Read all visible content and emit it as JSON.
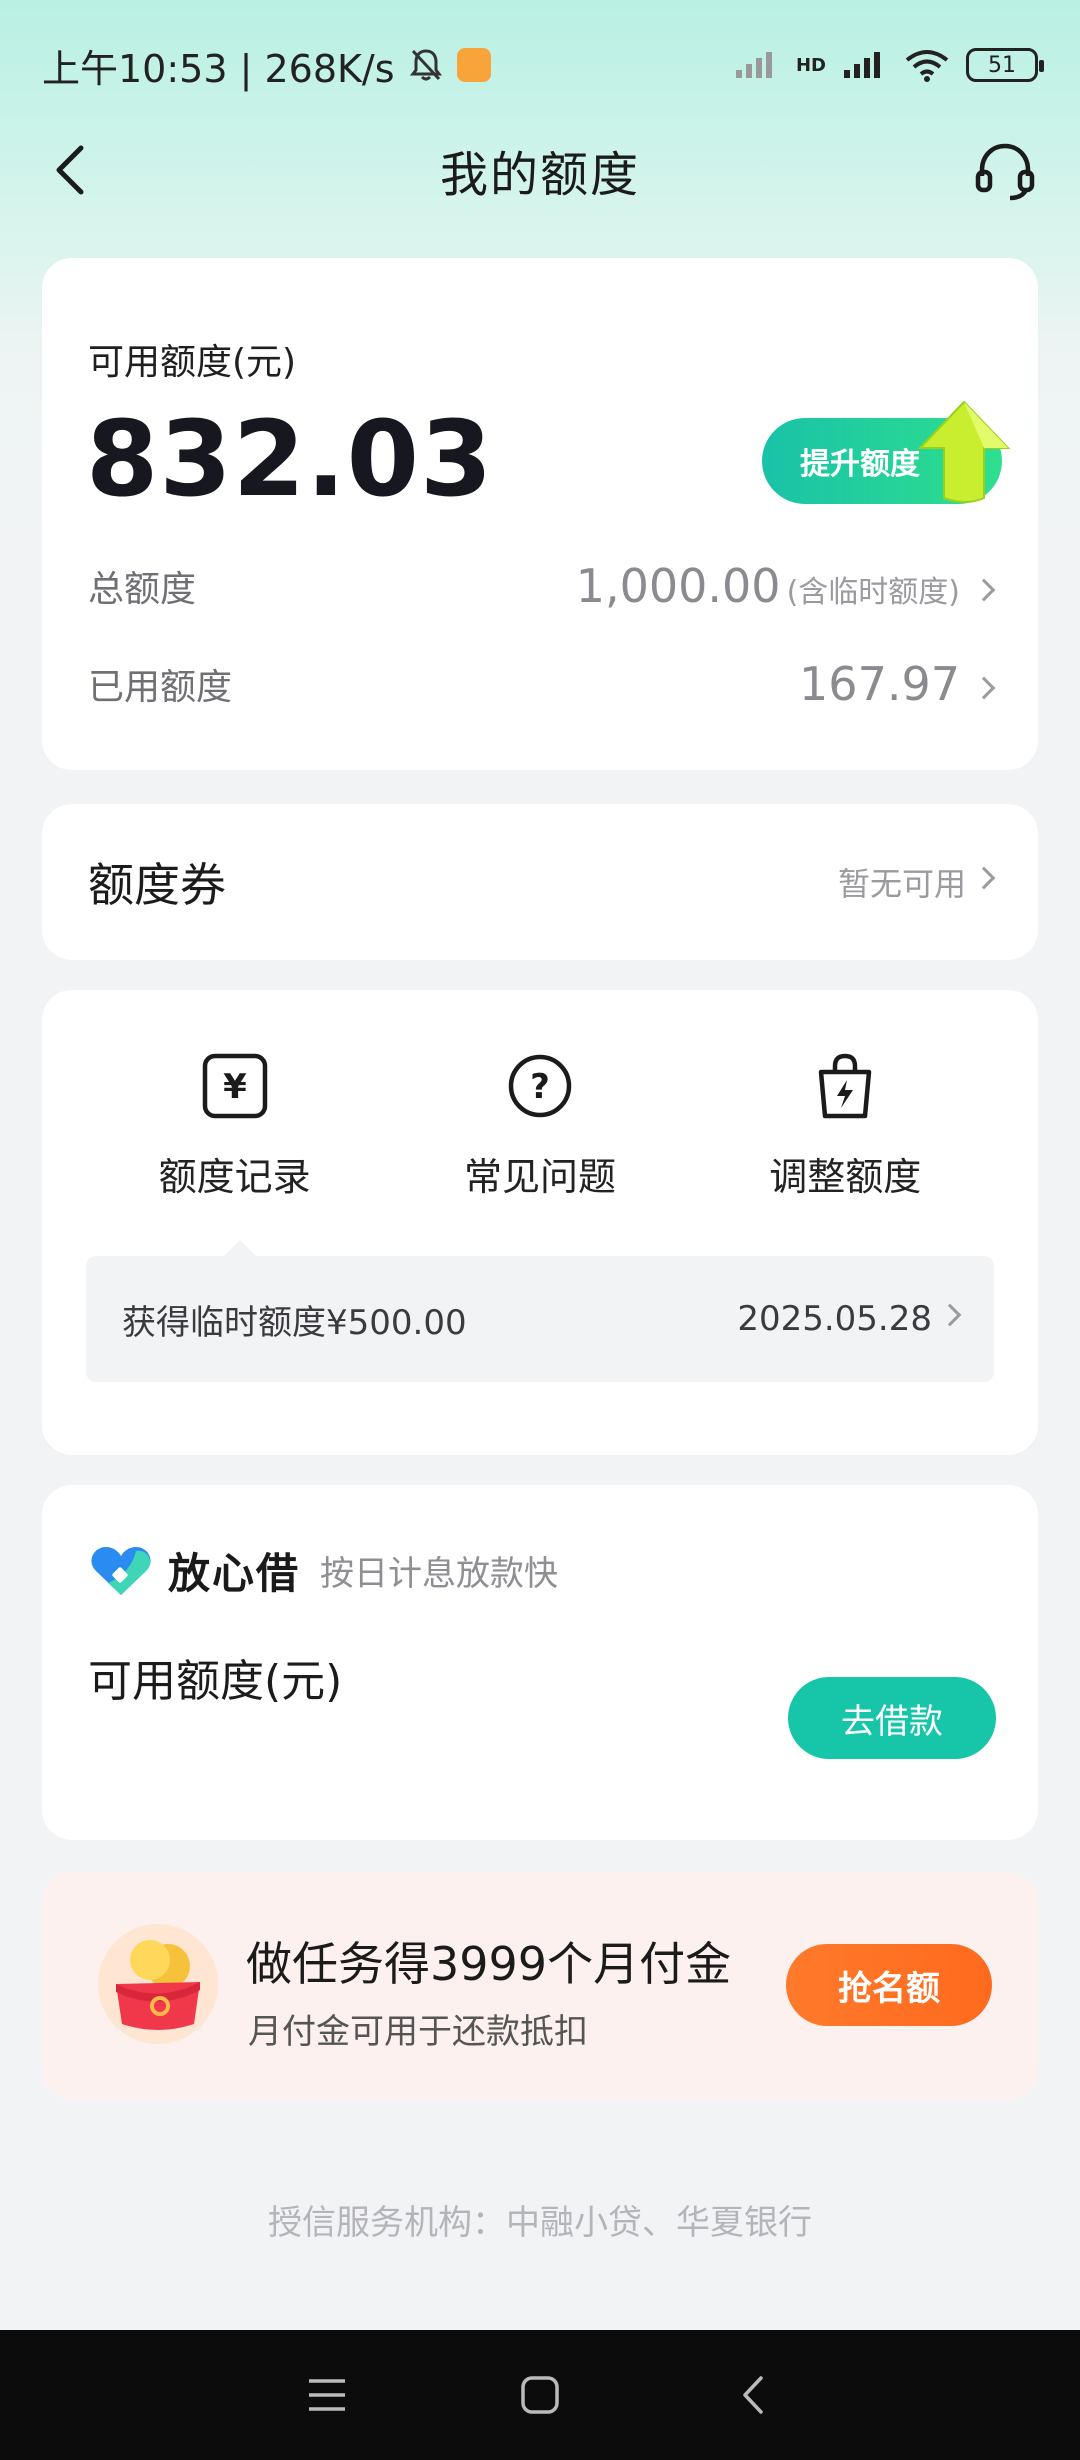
{
  "status_bar": {
    "time_and_speed": "上午10:53 | 268K/s",
    "network_label": "HD",
    "battery": "51"
  },
  "header": {
    "title": "我的额度"
  },
  "credit": {
    "available_label": "可用额度(元)",
    "available_amount": "832.03",
    "raise_button": "提升额度",
    "total_label": "总额度",
    "total_value": "1,000.00",
    "total_note": "(含临时额度)",
    "used_label": "已用额度",
    "used_value": "167.97"
  },
  "coupon": {
    "label": "额度券",
    "status": "暂无可用"
  },
  "tools": {
    "items": [
      {
        "label": "额度记录",
        "icon": "yuan-note-icon"
      },
      {
        "label": "常见问题",
        "icon": "question-circle-icon"
      },
      {
        "label": "调整额度",
        "icon": "bag-lightning-icon"
      }
    ],
    "notice_text": "获得临时额度¥500.00",
    "notice_date": "2025.05.28"
  },
  "loan": {
    "brand": "放心借",
    "slogan": "按日计息放款快",
    "available_label": "可用额度(元)",
    "borrow_button": "去借款"
  },
  "promo": {
    "title": "做任务得3999个月付金",
    "subtitle": "月付金可用于还款抵扣",
    "button": "抢名额"
  },
  "footer": {
    "note": "授信服务机构：中融小贷、华夏银行"
  },
  "colors": {
    "accent": "#17c6a9",
    "promo_button": "#ff6a1e",
    "header_gradient_top": "#b9f0e3"
  }
}
